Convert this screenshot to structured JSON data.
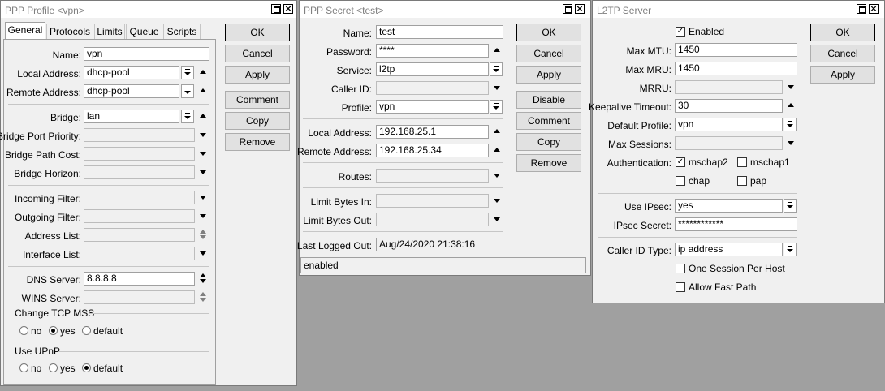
{
  "ppp_profile": {
    "title": "PPP Profile <vpn>",
    "tabs": [
      "General",
      "Protocols",
      "Limits",
      "Queue",
      "Scripts"
    ],
    "fields": {
      "name": {
        "label": "Name:",
        "value": "vpn"
      },
      "local_address": {
        "label": "Local Address:",
        "value": "dhcp-pool"
      },
      "remote_address": {
        "label": "Remote Address:",
        "value": "dhcp-pool"
      },
      "bridge": {
        "label": "Bridge:",
        "value": "lan"
      },
      "bridge_port_priority": {
        "label": "Bridge Port Priority:",
        "value": ""
      },
      "bridge_path_cost": {
        "label": "Bridge Path Cost:",
        "value": ""
      },
      "bridge_horizon": {
        "label": "Bridge Horizon:",
        "value": ""
      },
      "incoming_filter": {
        "label": "Incoming Filter:",
        "value": ""
      },
      "outgoing_filter": {
        "label": "Outgoing Filter:",
        "value": ""
      },
      "address_list": {
        "label": "Address List:",
        "value": ""
      },
      "interface_list": {
        "label": "Interface List:",
        "value": ""
      },
      "dns_server": {
        "label": "DNS Server:",
        "value": "8.8.8.8"
      },
      "wins_server": {
        "label": "WINS Server:",
        "value": ""
      }
    },
    "change_tcp_mss": {
      "label": "Change TCP MSS",
      "options": [
        "no",
        "yes",
        "default"
      ],
      "selected": "yes"
    },
    "use_upnp": {
      "label": "Use UPnP",
      "options": [
        "no",
        "yes",
        "default"
      ],
      "selected": "default"
    },
    "buttons": [
      "OK",
      "Cancel",
      "Apply",
      "Comment",
      "Copy",
      "Remove"
    ]
  },
  "ppp_secret": {
    "title": "PPP Secret <test>",
    "fields": {
      "name": {
        "label": "Name:",
        "value": "test"
      },
      "password": {
        "label": "Password:",
        "value": "****"
      },
      "service": {
        "label": "Service:",
        "value": "l2tp"
      },
      "caller_id": {
        "label": "Caller ID:",
        "value": ""
      },
      "profile": {
        "label": "Profile:",
        "value": "vpn"
      },
      "local_address": {
        "label": "Local Address:",
        "value": "192.168.25.1"
      },
      "remote_address": {
        "label": "Remote Address:",
        "value": "192.168.25.34"
      },
      "routes": {
        "label": "Routes:",
        "value": ""
      },
      "limit_bytes_in": {
        "label": "Limit Bytes In:",
        "value": ""
      },
      "limit_bytes_out": {
        "label": "Limit Bytes Out:",
        "value": ""
      },
      "last_logged_out": {
        "label": "Last Logged Out:",
        "value": "Aug/24/2020 21:38:16"
      }
    },
    "status": "enabled",
    "buttons": [
      "OK",
      "Cancel",
      "Apply",
      "Disable",
      "Comment",
      "Copy",
      "Remove"
    ]
  },
  "l2tp_server": {
    "title": "L2TP Server",
    "enabled": {
      "label": "Enabled",
      "checked": true
    },
    "fields": {
      "max_mtu": {
        "label": "Max MTU:",
        "value": "1450"
      },
      "max_mru": {
        "label": "Max MRU:",
        "value": "1450"
      },
      "mrru": {
        "label": "MRRU:",
        "value": ""
      },
      "keepalive_timeout": {
        "label": "Keepalive Timeout:",
        "value": "30"
      },
      "default_profile": {
        "label": "Default Profile:",
        "value": "vpn"
      },
      "max_sessions": {
        "label": "Max Sessions:",
        "value": ""
      },
      "use_ipsec": {
        "label": "Use IPsec:",
        "value": "yes"
      },
      "ipsec_secret": {
        "label": "IPsec Secret:",
        "value": "************"
      },
      "caller_id_type": {
        "label": "Caller ID Type:",
        "value": "ip address"
      }
    },
    "authentication": {
      "label": "Authentication:",
      "mschap2": {
        "label": "mschap2",
        "checked": true
      },
      "mschap1": {
        "label": "mschap1",
        "checked": false
      },
      "chap": {
        "label": "chap",
        "checked": false
      },
      "pap": {
        "label": "pap",
        "checked": false
      }
    },
    "one_session_per_host": {
      "label": "One Session Per Host",
      "checked": false
    },
    "allow_fast_path": {
      "label": "Allow Fast Path",
      "checked": false
    },
    "buttons": [
      "OK",
      "Cancel",
      "Apply"
    ]
  }
}
